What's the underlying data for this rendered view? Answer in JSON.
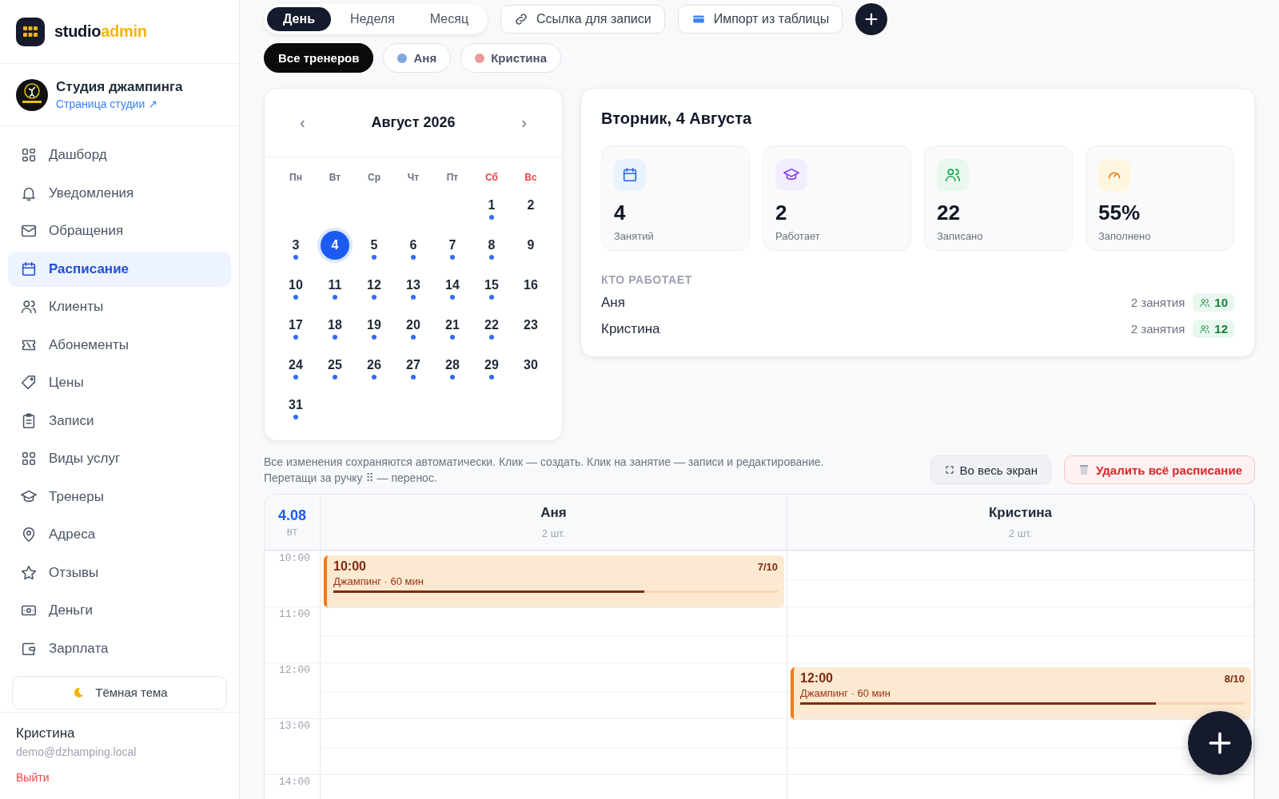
{
  "sidebar": {
    "brand": {
      "part_1": "studio",
      "part_2": "admin"
    },
    "studio": {
      "name": "Студия джампинга",
      "link": "Страница студии ↗"
    },
    "nav": [
      {
        "label": "Дашборд",
        "selected": false
      },
      {
        "label": "Уведомления",
        "selected": false
      },
      {
        "label": "Обращения",
        "selected": false
      },
      {
        "label": "Расписание",
        "selected": true
      },
      {
        "label": "Клиенты",
        "selected": false
      },
      {
        "label": "Абонементы",
        "selected": false
      },
      {
        "label": "Цены",
        "selected": false
      },
      {
        "label": "Записи",
        "selected": false
      },
      {
        "label": "Виды услуг",
        "selected": false
      },
      {
        "label": "Тренеры",
        "selected": false
      },
      {
        "label": "Адреса",
        "selected": false
      },
      {
        "label": "Отзывы",
        "selected": false
      },
      {
        "label": "Деньги",
        "selected": false
      },
      {
        "label": "Зарплата",
        "selected": false
      }
    ],
    "theme_button": "Тёмная тема",
    "user": {
      "name": "Кристина",
      "email": "demo@dzhamping.local",
      "logout": "Выйти"
    }
  },
  "toolbar": {
    "views": [
      {
        "label": "День",
        "selected": true
      },
      {
        "label": "Неделя",
        "selected": false
      },
      {
        "label": "Месяц",
        "selected": false
      }
    ],
    "buttons": [
      {
        "label": "Ссылка для записи",
        "kind": "link"
      },
      {
        "label": "Импорт из таблицы",
        "kind": "import"
      }
    ]
  },
  "filters": [
    {
      "label": "Все тренеров",
      "selected": true
    },
    {
      "label": "Аня",
      "selected": false,
      "color": "#7fa6e0"
    },
    {
      "label": "Кристина",
      "selected": false,
      "color": "#e89a9a"
    }
  ],
  "calendar": {
    "prev": "‹",
    "title": "Август 2026",
    "next": "›",
    "weekdays": [
      {
        "label": "Пн",
        "weekend": false
      },
      {
        "label": "Вт",
        "weekend": false
      },
      {
        "label": "Ср",
        "weekend": false
      },
      {
        "label": "Чт",
        "weekend": false
      },
      {
        "label": "Пт",
        "weekend": false
      },
      {
        "label": "Сб",
        "weekend": true
      },
      {
        "label": "Вс",
        "weekend": true
      }
    ],
    "weeks": [
      {
        "days": [
          {
            "day": "1",
            "events": true,
            "selected": false
          },
          {
            "day": "2",
            "events": false,
            "selected": false
          }
        ]
      },
      {
        "days": [
          {
            "day": "3",
            "events": true,
            "selected": false
          },
          {
            "day": "4",
            "events": false,
            "selected": true
          },
          {
            "day": "5",
            "events": true,
            "selected": false
          },
          {
            "day": "6",
            "events": true,
            "selected": false
          },
          {
            "day": "7",
            "events": true,
            "selected": false
          },
          {
            "day": "8",
            "events": true,
            "selected": false
          },
          {
            "day": "9",
            "events": false,
            "selected": false
          }
        ]
      },
      {
        "days": [
          {
            "day": "10",
            "events": true,
            "selected": false
          },
          {
            "day": "11",
            "events": true,
            "selected": false
          },
          {
            "day": "12",
            "events": true,
            "selected": false
          },
          {
            "day": "13",
            "events": true,
            "selected": false
          },
          {
            "day": "14",
            "events": true,
            "selected": false
          },
          {
            "day": "15",
            "events": true,
            "selected": false
          },
          {
            "day": "16",
            "events": false,
            "selected": false
          }
        ]
      },
      {
        "days": [
          {
            "day": "17",
            "events": true,
            "selected": false
          },
          {
            "day": "18",
            "events": true,
            "selected": false
          },
          {
            "day": "19",
            "events": true,
            "selected": false
          },
          {
            "day": "20",
            "events": true,
            "selected": false
          },
          {
            "day": "21",
            "events": true,
            "selected": false
          },
          {
            "day": "22",
            "events": true,
            "selected": false
          },
          {
            "day": "23",
            "events": false,
            "selected": false
          }
        ]
      },
      {
        "days": [
          {
            "day": "24",
            "events": true,
            "selected": false
          },
          {
            "day": "25",
            "events": true,
            "selected": false
          },
          {
            "day": "26",
            "events": true,
            "selected": false
          },
          {
            "day": "27",
            "events": true,
            "selected": false
          },
          {
            "day": "28",
            "events": true,
            "selected": false
          },
          {
            "day": "29",
            "events": true,
            "selected": false
          },
          {
            "day": "30",
            "events": false,
            "selected": false
          }
        ]
      },
      {
        "days": [
          {
            "day": "31",
            "events": true,
            "selected": false
          }
        ]
      }
    ]
  },
  "day_panel": {
    "title": "Вторник, 4 Августа",
    "stats": [
      {
        "kind": "calendar",
        "value": "4",
        "label": "Занятий"
      },
      {
        "kind": "cap",
        "value": "2",
        "label": "Работает"
      },
      {
        "kind": "people",
        "value": "22",
        "label": "Записано"
      },
      {
        "kind": "gauge",
        "value": "55%",
        "label": "Заполнено"
      }
    ],
    "working_title": "КТО РАБОТАЕТ",
    "working": [
      {
        "name": "Аня",
        "sessions": "2 занятия",
        "clients": "10"
      },
      {
        "name": "Кристина",
        "sessions": "2 занятия",
        "clients": "12"
      }
    ]
  },
  "hint": "Все изменения сохраняются автоматически. Клик — создать. Клик на занятие — записи и редактирование. Перетащи за ручку ⠿ — перенос.",
  "actions": [
    {
      "label": "Во весь экран",
      "kind": "fullscreen"
    },
    {
      "label": "Удалить всё расписание",
      "kind": "danger"
    }
  ],
  "schedule": {
    "date": "4.08",
    "weekday": "ВТ",
    "columns": [
      {
        "name": "Аня",
        "count": "2 шт."
      },
      {
        "name": "Кристина",
        "count": "2 шт."
      }
    ],
    "rows": [
      {
        "time": "10:00",
        "cells": [
          {
            "kind": "event",
            "time": "10:00",
            "title": "Джампинг · 60 мин",
            "count": "7/10",
            "level": 0.7
          },
          {
            "kind": "empty"
          }
        ]
      },
      {
        "time": "11:00",
        "cells": [
          {
            "kind": "empty"
          },
          {
            "kind": "empty"
          }
        ]
      },
      {
        "time": "12:00",
        "cells": [
          {
            "kind": "empty"
          },
          {
            "kind": "event",
            "time": "12:00",
            "title": "Джампинг · 60 мин",
            "count": "8/10",
            "level": 0.8
          }
        ]
      },
      {
        "time": "13:00",
        "cells": [
          {
            "kind": "empty"
          },
          {
            "kind": "empty"
          }
        ]
      },
      {
        "time": "14:00",
        "cells": [
          {
            "kind": "empty"
          },
          {
            "kind": "empty"
          }
        ]
      }
    ]
  }
}
